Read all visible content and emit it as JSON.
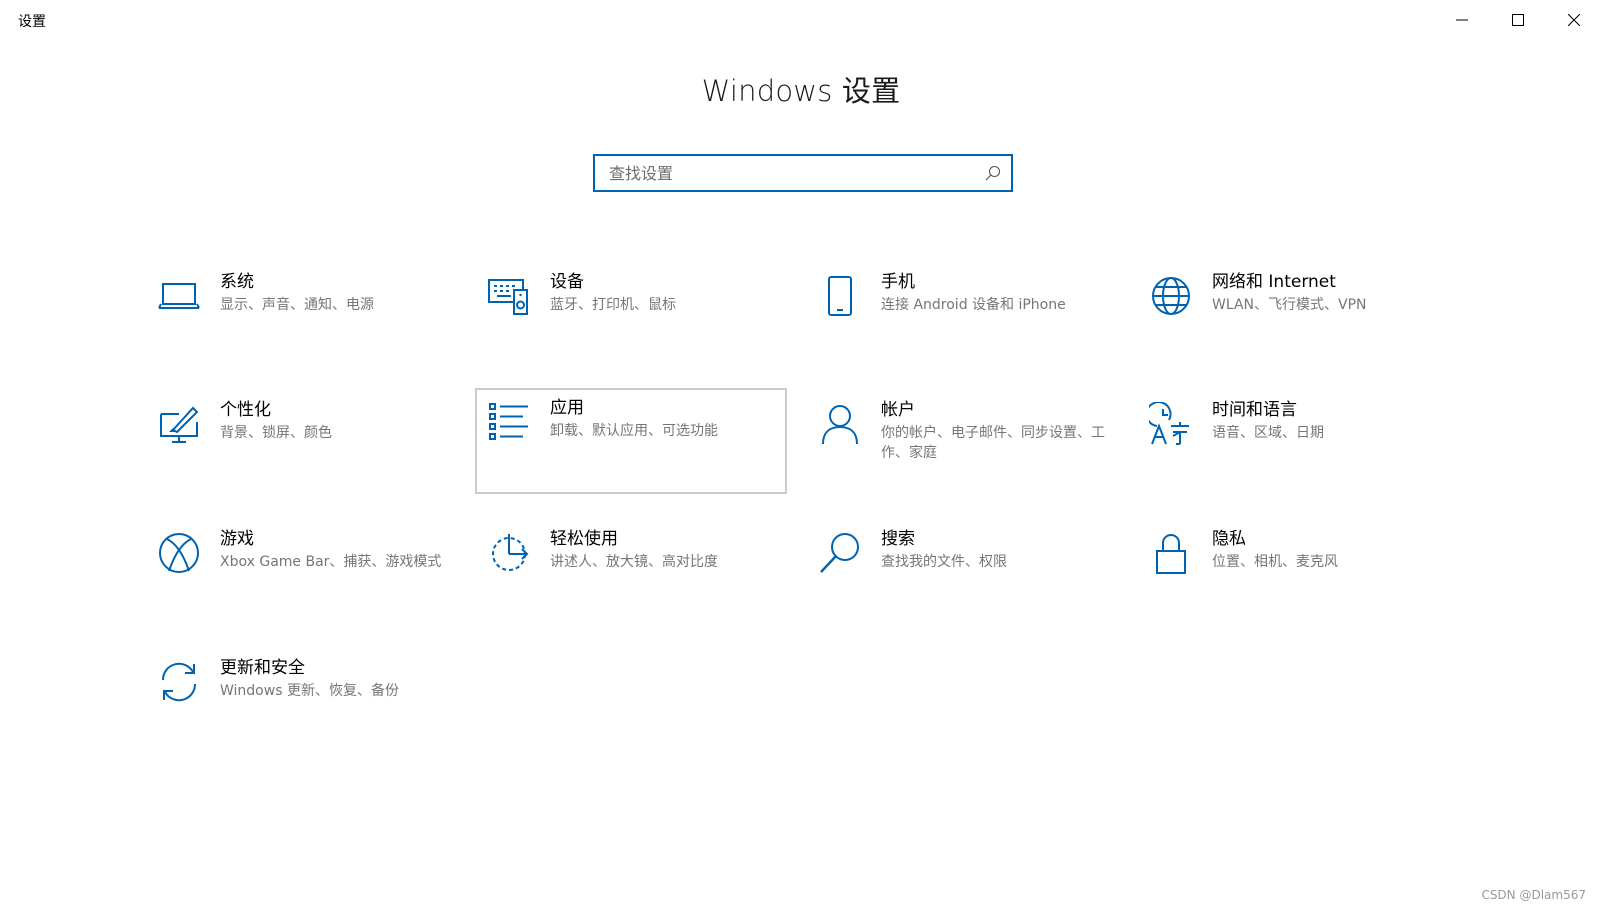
{
  "window": {
    "title": "设置"
  },
  "page": {
    "title": "Windows 设置"
  },
  "search": {
    "placeholder": "查找设置",
    "value": ""
  },
  "colors": {
    "accent": "#0063b1"
  },
  "tiles": [
    {
      "label": "系统",
      "desc": "显示、声音、通知、电源",
      "icon": "laptop-icon"
    },
    {
      "label": "设备",
      "desc": "蓝牙、打印机、鼠标",
      "icon": "devices-icon"
    },
    {
      "label": "手机",
      "desc": "连接 Android 设备和 iPhone",
      "icon": "phone-icon"
    },
    {
      "label": "网络和 Internet",
      "desc": "WLAN、飞行模式、VPN",
      "icon": "globe-icon"
    },
    {
      "label": "个性化",
      "desc": "背景、锁屏、颜色",
      "icon": "personalization-icon"
    },
    {
      "label": "应用",
      "desc": "卸载、默认应用、可选功能",
      "icon": "apps-list-icon"
    },
    {
      "label": "帐户",
      "desc": "你的帐户、电子邮件、同步设置、工作、家庭",
      "icon": "person-icon"
    },
    {
      "label": "时间和语言",
      "desc": "语音、区域、日期",
      "icon": "time-language-icon"
    },
    {
      "label": "游戏",
      "desc": "Xbox Game Bar、捕获、游戏模式",
      "icon": "xbox-icon"
    },
    {
      "label": "轻松使用",
      "desc": "讲述人、放大镜、高对比度",
      "icon": "ease-of-access-icon"
    },
    {
      "label": "搜索",
      "desc": "查找我的文件、权限",
      "icon": "search-icon"
    },
    {
      "label": "隐私",
      "desc": "位置、相机、麦克风",
      "icon": "lock-icon"
    },
    {
      "label": "更新和安全",
      "desc": "Windows 更新、恢复、备份",
      "icon": "update-icon"
    }
  ],
  "watermark": "CSDN @Dlam567"
}
